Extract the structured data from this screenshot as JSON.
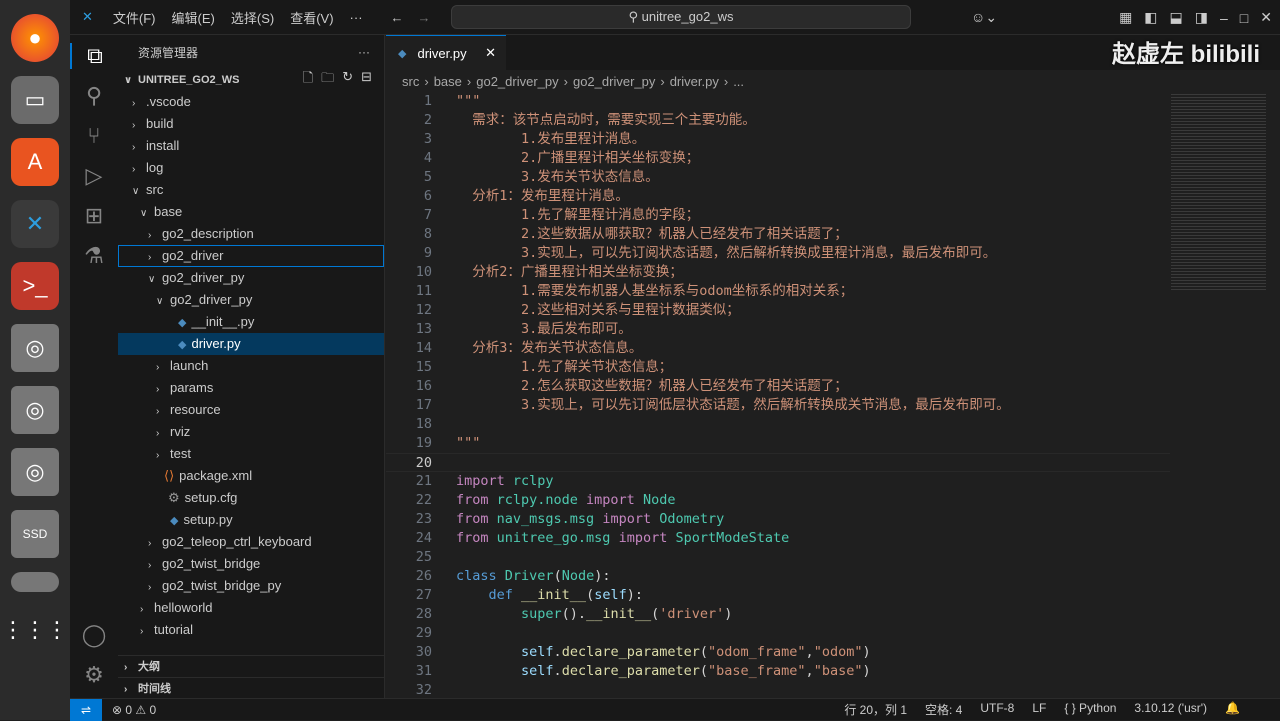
{
  "menu": {
    "items": [
      "文件(F)",
      "编辑(E)",
      "选择(S)",
      "查看(V)",
      "···"
    ],
    "search": "⚲ unitree_go2_ws"
  },
  "watermark": "赵虚左 bilibili",
  "sidebar": {
    "title": "资源管理器",
    "more": "···",
    "workspace": "UNITREE_GO2_WS",
    "tree": [
      {
        "label": ".vscode",
        "depth": 1,
        "type": "closed"
      },
      {
        "label": "build",
        "depth": 1,
        "type": "closed"
      },
      {
        "label": "install",
        "depth": 1,
        "type": "closed"
      },
      {
        "label": "log",
        "depth": 1,
        "type": "closed"
      },
      {
        "label": "src",
        "depth": 1,
        "type": "open"
      },
      {
        "label": "base",
        "depth": 2,
        "type": "open"
      },
      {
        "label": "go2_description",
        "depth": 3,
        "type": "closed"
      },
      {
        "label": "go2_driver",
        "depth": 3,
        "type": "closed",
        "focus": true
      },
      {
        "label": "go2_driver_py",
        "depth": 3,
        "type": "open"
      },
      {
        "label": "go2_driver_py",
        "depth": 4,
        "type": "open"
      },
      {
        "label": "__init__.py",
        "depth": 5,
        "type": "py"
      },
      {
        "label": "driver.py",
        "depth": 5,
        "type": "py",
        "selected": true
      },
      {
        "label": "launch",
        "depth": 4,
        "type": "closed"
      },
      {
        "label": "params",
        "depth": 4,
        "type": "closed"
      },
      {
        "label": "resource",
        "depth": 4,
        "type": "closed"
      },
      {
        "label": "rviz",
        "depth": 4,
        "type": "closed"
      },
      {
        "label": "test",
        "depth": 4,
        "type": "closed"
      },
      {
        "label": "package.xml",
        "depth": 4,
        "type": "xml"
      },
      {
        "label": "setup.cfg",
        "depth": 4,
        "type": "cfg"
      },
      {
        "label": "setup.py",
        "depth": 4,
        "type": "py"
      },
      {
        "label": "go2_teleop_ctrl_keyboard",
        "depth": 3,
        "type": "closed"
      },
      {
        "label": "go2_twist_bridge",
        "depth": 3,
        "type": "closed"
      },
      {
        "label": "go2_twist_bridge_py",
        "depth": 3,
        "type": "closed"
      },
      {
        "label": "helloworld",
        "depth": 2,
        "type": "closed"
      },
      {
        "label": "tutorial",
        "depth": 2,
        "type": "closed"
      }
    ],
    "outline": "大纲",
    "timeline": "时间线"
  },
  "editor": {
    "tab": "driver.py",
    "breadcrumb": [
      "src",
      "base",
      "go2_driver_py",
      "go2_driver_py",
      "driver.py",
      "..."
    ],
    "current_line": 20,
    "lines": [
      [
        [
          "s",
          "\"\"\""
        ]
      ],
      [
        [
          "s",
          "  需求：该节点启动时，需要实现三个主要功能。"
        ]
      ],
      [
        [
          "s",
          "        1.发布里程计消息。"
        ]
      ],
      [
        [
          "s",
          "        2.广播里程计相关坐标变换；"
        ]
      ],
      [
        [
          "s",
          "        3.发布关节状态信息。"
        ]
      ],
      [
        [
          "s",
          "  分析1：发布里程计消息。"
        ]
      ],
      [
        [
          "s",
          "        1.先了解里程计消息的字段；"
        ]
      ],
      [
        [
          "s",
          "        2.这些数据从哪获取？机器人已经发布了相关话题了；"
        ]
      ],
      [
        [
          "s",
          "        3.实现上，可以先订阅状态话题，然后解析转换成里程计消息，最后发布即可。"
        ]
      ],
      [
        [
          "s",
          "  分析2：广播里程计相关坐标变换；"
        ]
      ],
      [
        [
          "s",
          "        1.需要发布机器人基坐标系与odom坐标系的相对关系；"
        ]
      ],
      [
        [
          "s",
          "        2.这些相对关系与里程计数据类似；"
        ]
      ],
      [
        [
          "s",
          "        3.最后发布即可。"
        ]
      ],
      [
        [
          "s",
          "  分析3：发布关节状态信息。"
        ]
      ],
      [
        [
          "s",
          "        1.先了解关节状态信息；"
        ]
      ],
      [
        [
          "s",
          "        2.怎么获取这些数据？机器人已经发布了相关话题了；"
        ]
      ],
      [
        [
          "s",
          "        3.实现上，可以先订阅低层状态话题，然后解析转换成关节消息，最后发布即可。"
        ]
      ],
      [],
      [
        [
          "s",
          "\"\"\""
        ]
      ],
      [],
      [
        [
          "k",
          "import "
        ],
        [
          "t",
          "rclpy"
        ]
      ],
      [
        [
          "k",
          "from "
        ],
        [
          "t",
          "rclpy.node "
        ],
        [
          "k",
          "import "
        ],
        [
          "t",
          "Node"
        ]
      ],
      [
        [
          "k",
          "from "
        ],
        [
          "t",
          "nav_msgs.msg "
        ],
        [
          "k",
          "import "
        ],
        [
          "t",
          "Odometry"
        ]
      ],
      [
        [
          "k",
          "from "
        ],
        [
          "t",
          "unitree_go.msg "
        ],
        [
          "k",
          "import "
        ],
        [
          "t",
          "SportModeState"
        ]
      ],
      [],
      [
        [
          "b",
          "class "
        ],
        [
          "t",
          "Driver"
        ],
        [
          "p",
          "("
        ],
        [
          "t",
          "Node"
        ],
        [
          "p",
          "):"
        ]
      ],
      [
        [
          "p",
          "    "
        ],
        [
          "b",
          "def "
        ],
        [
          "f",
          "__init__"
        ],
        [
          "p",
          "("
        ],
        [
          "v",
          "self"
        ],
        [
          "p",
          "):"
        ]
      ],
      [
        [
          "p",
          "        "
        ],
        [
          "t",
          "super"
        ],
        [
          "p",
          "()."
        ],
        [
          "f",
          "__init__"
        ],
        [
          "p",
          "("
        ],
        [
          "s",
          "'driver'"
        ],
        [
          "p",
          ")"
        ]
      ],
      [],
      [
        [
          "p",
          "        "
        ],
        [
          "v",
          "self"
        ],
        [
          "p",
          "."
        ],
        [
          "f",
          "declare_parameter"
        ],
        [
          "p",
          "("
        ],
        [
          "s",
          "\"odom_frame\""
        ],
        [
          "p",
          ","
        ],
        [
          "s",
          "\"odom\""
        ],
        [
          "p",
          ")"
        ]
      ],
      [
        [
          "p",
          "        "
        ],
        [
          "v",
          "self"
        ],
        [
          "p",
          "."
        ],
        [
          "f",
          "declare_parameter"
        ],
        [
          "p",
          "("
        ],
        [
          "s",
          "\"base_frame\""
        ],
        [
          "p",
          ","
        ],
        [
          "s",
          "\"base\""
        ],
        [
          "p",
          ")"
        ]
      ],
      []
    ]
  },
  "status": {
    "problems": "⊗ 0  ⚠ 0",
    "position": "行 20，列 1",
    "indent": "空格: 4",
    "encoding": "UTF-8",
    "eol": "LF",
    "language": "{ } Python",
    "interpreter": "3.10.12 ('usr')"
  }
}
